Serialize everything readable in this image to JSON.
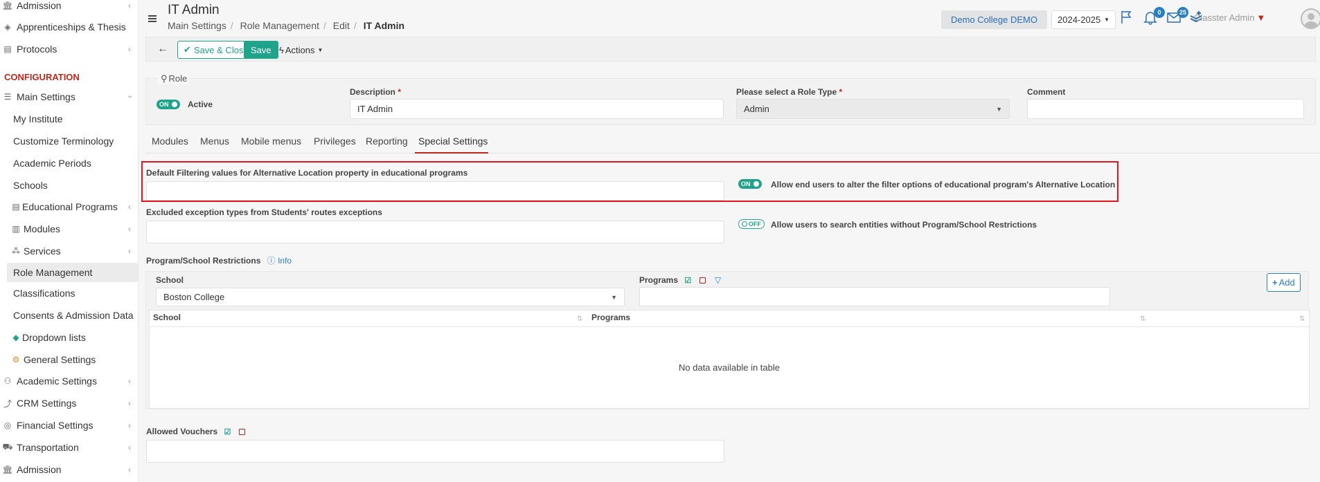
{
  "sidebar": {
    "items_top": [
      {
        "label": "Admission",
        "icon": "bank-icon",
        "chev": true
      },
      {
        "label": "Apprenticeships & Thesis",
        "icon": "box-icon",
        "chev": false
      },
      {
        "label": "Protocols",
        "icon": "document-icon",
        "chev": true
      }
    ],
    "section": "CONFIGURATION",
    "main_settings": {
      "label": "Main Settings",
      "icon": "sliders-icon"
    },
    "sub_items": [
      {
        "label": "My Institute"
      },
      {
        "label": "Customize Terminology"
      },
      {
        "label": "Academic Periods"
      },
      {
        "label": "Schools"
      },
      {
        "label": "Educational Programs",
        "icon": "list-icon",
        "chev": true
      },
      {
        "label": "Modules",
        "icon": "book-icon",
        "chev": true
      },
      {
        "label": "Services",
        "icon": "nodes-icon",
        "chev": true
      },
      {
        "label": "Role Management",
        "active": true
      },
      {
        "label": "Classifications"
      },
      {
        "label": "Consents & Admission Data"
      },
      {
        "label": "Dropdown lists",
        "icon": "layers-icon"
      },
      {
        "label": "General Settings",
        "icon": "gear-icon"
      }
    ],
    "items_bottom": [
      {
        "label": "Academic Settings",
        "icon": "people-icon",
        "chev": true
      },
      {
        "label": "CRM Settings",
        "icon": "chart-icon",
        "chev": true
      },
      {
        "label": "Financial Settings",
        "icon": "coins-icon",
        "chev": true
      },
      {
        "label": "Transportation",
        "icon": "bus-icon",
        "chev": true
      },
      {
        "label": "Admission",
        "icon": "bank-icon",
        "chev": true
      }
    ]
  },
  "header": {
    "title": "IT Admin",
    "breadcrumb": [
      "Main Settings",
      "Role Management",
      "Edit",
      "IT Admin"
    ],
    "college": "Demo College DEMO",
    "year": "2024-2025",
    "notifications_count": "0",
    "messages_count": "25",
    "user": "Classter Admin"
  },
  "toolbar": {
    "save_close": "Save & Close",
    "save": "Save",
    "actions": "Actions"
  },
  "role": {
    "legend": "Role",
    "active_toggle": "ON",
    "active_label": "Active",
    "description_label": "Description",
    "description_value": "IT Admin",
    "role_type_label": "Please select a Role Type",
    "role_type_value": "Admin",
    "comment_label": "Comment",
    "comment_value": ""
  },
  "tabs": [
    "Modules",
    "Menus",
    "Mobile menus",
    "Privileges",
    "Reporting",
    "Special Settings"
  ],
  "special": {
    "default_filter_label": "Default Filtering values for Alternative Location property in educational programs",
    "allow_alter_toggle": "ON",
    "allow_alter_label": "Allow end users to alter the filter options of educational program's Alternative Location",
    "excluded_label": "Excluded exception types from Students' routes exceptions",
    "allow_search_toggle": "OFF",
    "allow_search_label": "Allow users to search entities without Program/School Restrictions",
    "restrictions_label": "Program/School Restrictions",
    "info": "Info",
    "school_label": "School",
    "school_value": "Boston College",
    "programs_label": "Programs",
    "add": "Add",
    "col_school": "School",
    "col_programs": "Programs",
    "empty": "No data available in table",
    "vouchers_label": "Allowed Vouchers"
  }
}
